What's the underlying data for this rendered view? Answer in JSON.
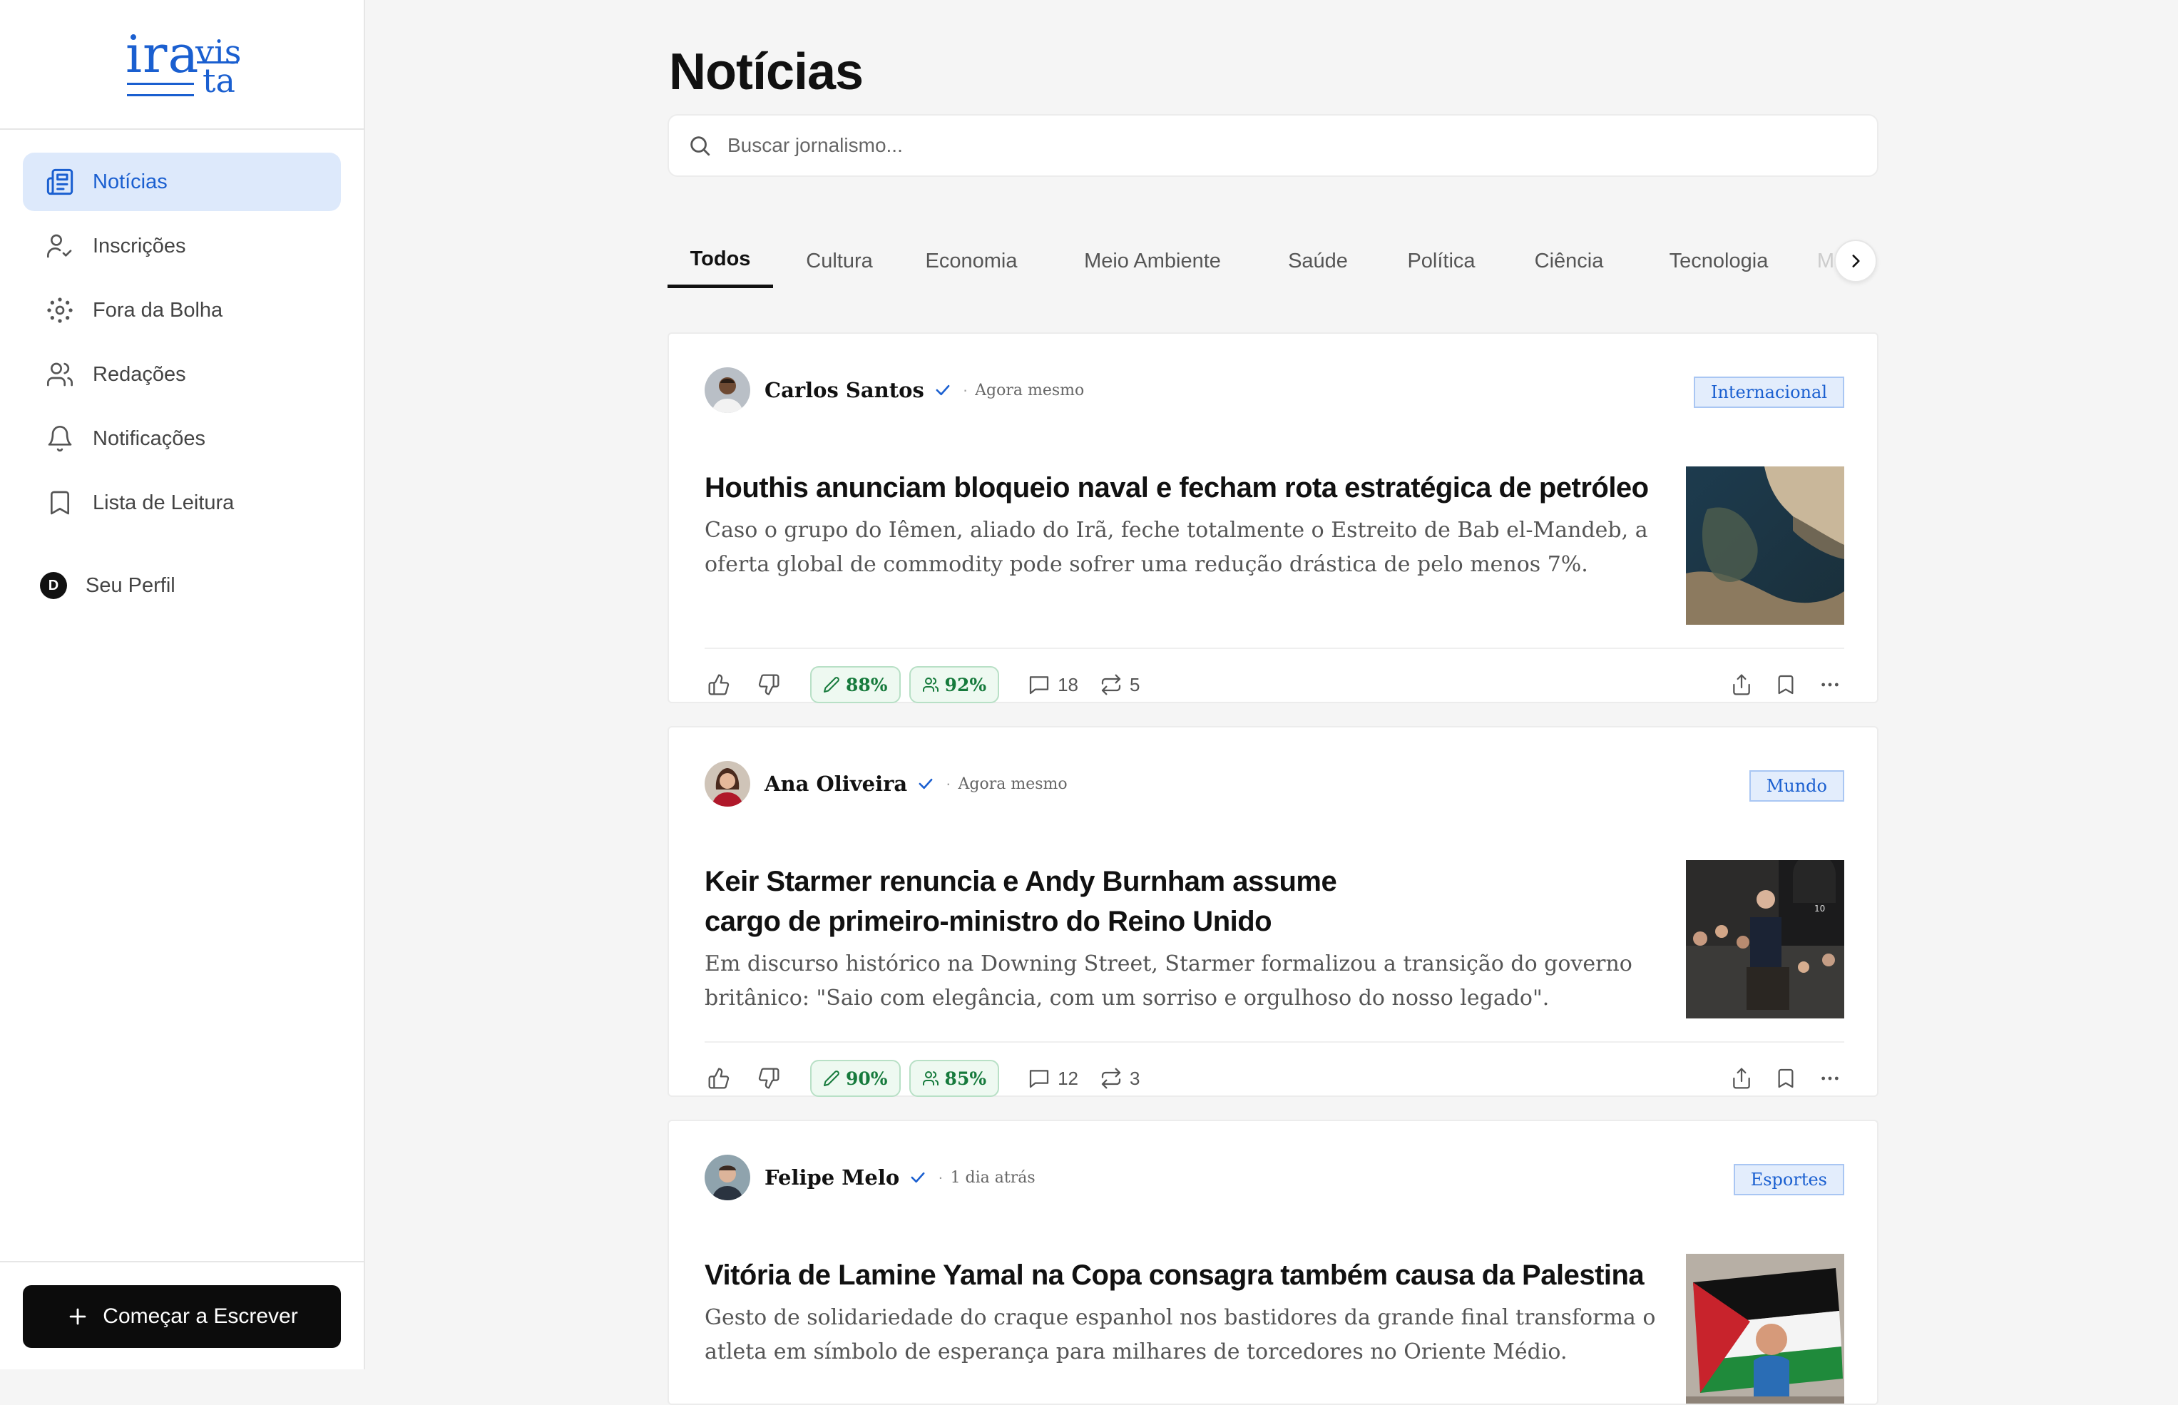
{
  "logo": {
    "line1": "ira",
    "line2": "vis",
    "line3": "ta"
  },
  "sidebar": {
    "items": [
      {
        "label": "Notícias",
        "icon": "newspaper-icon",
        "active": true
      },
      {
        "label": "Inscrições",
        "icon": "user-check-icon"
      },
      {
        "label": "Fora da Bolha",
        "icon": "orbit-icon"
      },
      {
        "label": "Redações",
        "icon": "users-icon"
      },
      {
        "label": "Notificações",
        "icon": "bell-icon"
      },
      {
        "label": "Lista de Leitura",
        "icon": "bookmark-icon"
      }
    ],
    "profile": {
      "initial": "D",
      "label": "Seu Perfil"
    },
    "write_button": "Começar a Escrever"
  },
  "main": {
    "title": "Notícias",
    "search": {
      "placeholder": "Buscar jornalismo..."
    },
    "tabs": [
      "Todos",
      "Cultura",
      "Economia",
      "Meio Ambiente",
      "Saúde",
      "Política",
      "Ciência",
      "Tecnologia",
      "M"
    ],
    "active_tab": "Todos"
  },
  "articles": [
    {
      "author": "Carlos Santos",
      "time": "Agora mesmo",
      "tag": "Internacional",
      "headline": "Houthis anunciam bloqueio naval e fecham rota estratégica de petróleo",
      "excerpt": "Caso o grupo do Iêmen, aliado do Irã, feche totalmente o Estreito de Bab el-Mandeb, a oferta global de commodity pode sofrer uma redução drástica de pelo menos 7%.",
      "score_quality": "88%",
      "score_audience": "92%",
      "comments": "18",
      "reposts": "5"
    },
    {
      "author": "Ana Oliveira",
      "time": "Agora mesmo",
      "tag": "Mundo",
      "headline": "Keir Starmer renuncia e Andy Burnham assume cargo de primeiro-ministro do Reino Unido",
      "excerpt": "Em discurso histórico na Downing Street, Starmer formalizou a transição do governo britânico: \"Saio com elegância, com um sorriso e orgulhoso do nosso legado\".",
      "score_quality": "90%",
      "score_audience": "85%",
      "comments": "12",
      "reposts": "3"
    },
    {
      "author": "Felipe Melo",
      "time": "1 dia atrás",
      "tag": "Esportes",
      "headline": "Vitória de Lamine Yamal na Copa consagra também causa da Palestina",
      "excerpt": "Gesto de solidariedade do craque espanhol nos bastidores da grande final transforma o atleta em símbolo de esperança para milhares de torcedores no Oriente Médio."
    }
  ],
  "colors": {
    "accent": "#1a5fd0",
    "active_bg": "#dde9fb",
    "score_green": "#167a3c",
    "tag_bg": "#e3edfc"
  }
}
